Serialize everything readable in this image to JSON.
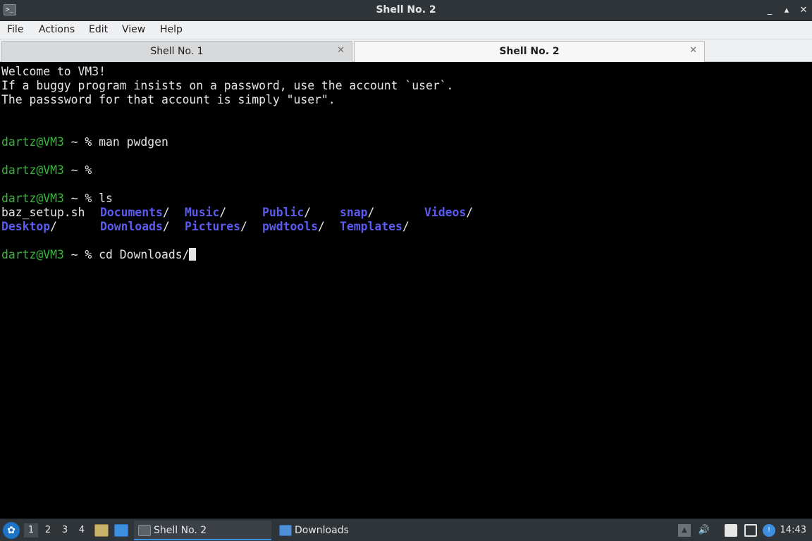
{
  "window": {
    "title": "Shell No. 2",
    "icon": "terminal-icon"
  },
  "menu": [
    "File",
    "Actions",
    "Edit",
    "View",
    "Help"
  ],
  "tabs": [
    {
      "label": "Shell No. 1",
      "active": false
    },
    {
      "label": "Shell No. 2",
      "active": true
    }
  ],
  "terminal": {
    "welcome": [
      "Welcome to VM3!",
      "If a buggy program insists on a password, use the account `user`.",
      "The passsword for that account is simply \"user\"."
    ],
    "prompt_user": "dartz@VM3",
    "prompt_rest": " ~ % ",
    "commands": [
      "man pwdgen",
      "",
      "ls",
      "cd Downloads/"
    ],
    "ls_file": "baz_setup.sh",
    "ls_dirs": [
      [
        "Documents",
        "Music",
        "Public",
        "snap",
        "Videos"
      ],
      [
        "Desktop",
        "Downloads",
        "Pictures",
        "pwdtools",
        "Templates"
      ]
    ],
    "colors": {
      "prompt_user": "#35b839",
      "directory": "#5b5bf0",
      "text": "#e6e6e6",
      "background": "#000000"
    }
  },
  "taskbar": {
    "workspaces": [
      "1",
      "2",
      "3",
      "4"
    ],
    "tasks": [
      {
        "label": "Shell No. 2",
        "icon": "terminal-icon",
        "active": true
      },
      {
        "label": "Downloads",
        "icon": "folder-icon",
        "active": false
      }
    ],
    "clock": "14:43",
    "tray_icons": [
      "arrow-up-icon",
      "volume-icon",
      "clipboard-icon",
      "network-icon",
      "notification-icon"
    ]
  }
}
